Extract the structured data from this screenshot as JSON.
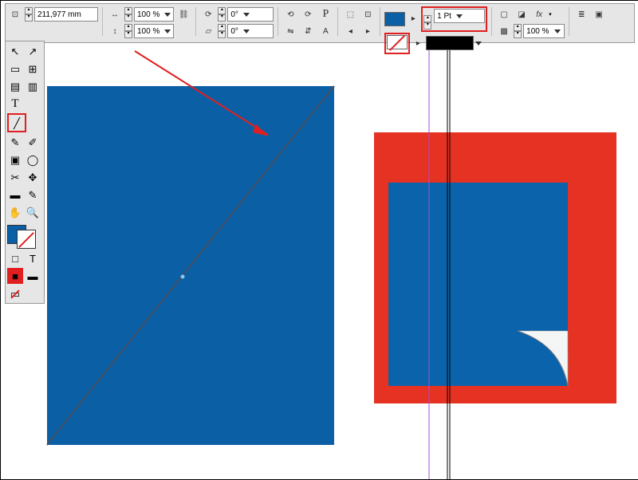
{
  "topbar": {
    "coord_value": "211,977 mm",
    "scale_x": "100 %",
    "scale_y": "100 %",
    "rotate": "0°",
    "shear": "0°",
    "stroke_weight": "1 Pt",
    "opacity": "100 %"
  },
  "tools": {
    "selection": "↖",
    "direct": "↗",
    "page": "▭",
    "gap": "⊞",
    "pages": "▤",
    "gaps": "▥",
    "text": "T",
    "line": "╱",
    "pen": "✎",
    "pencil": "✐",
    "frame": "▣",
    "ellipse": "◯",
    "scissors": "✂",
    "transform": "✥",
    "gradient": "▬",
    "eyedrop": "✎",
    "hand": "✋",
    "zoom": "🔍",
    "swap": "⇄",
    "default": "□",
    "fmtA": "□",
    "fmtB": "T",
    "applyFill": "■",
    "applyNone": "▬",
    "applyGrad": "▭"
  },
  "colors": {
    "fill": "#0a5fa5",
    "red": "#e02020",
    "blue": "#0b63ab",
    "canvas": "#ffffff"
  }
}
